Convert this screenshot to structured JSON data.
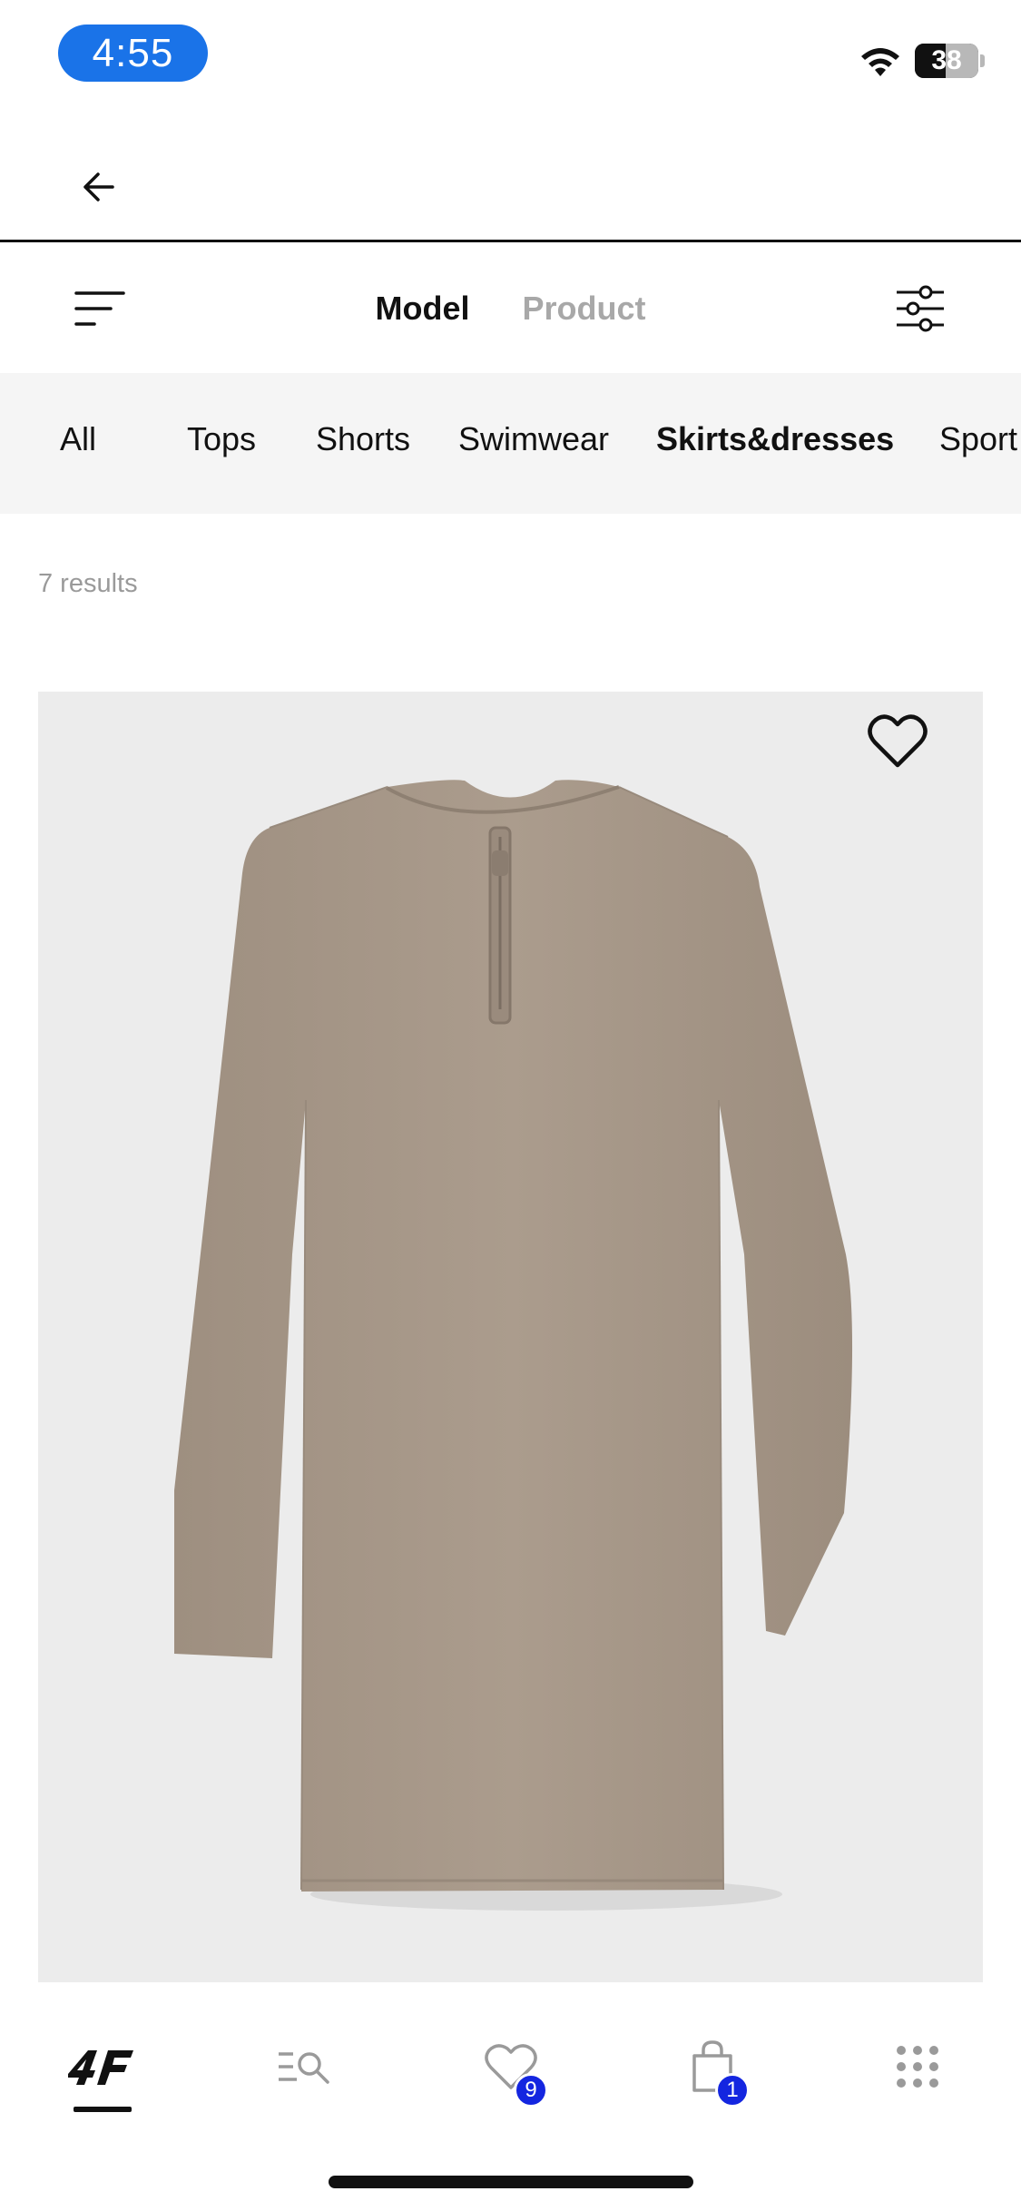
{
  "status_bar": {
    "time": "4:55",
    "battery": "38",
    "icons": [
      "wifi-icon",
      "battery-icon"
    ]
  },
  "header": {
    "back_icon": "arrow-left-icon"
  },
  "view_toggle": {
    "options": [
      "Model",
      "Product"
    ],
    "selected": "Model",
    "menu_icon": "sort-lines-icon",
    "filter_icon": "sliders-icon"
  },
  "categories": {
    "items": [
      "All",
      "Tops",
      "Shorts",
      "Swimwear",
      "Skirts&dresses",
      "Sport"
    ],
    "selected": "Skirts&dresses"
  },
  "results": {
    "label": "7 results"
  },
  "product": {
    "image": "long-sleeve-ribbed-dress",
    "favorite_icon": "heart-outline-icon",
    "dress_color": "#a8998a",
    "background_color": "#ececec"
  },
  "bottom_nav": {
    "items": [
      {
        "icon": "4f-logo-icon",
        "active": true
      },
      {
        "icon": "search-list-icon",
        "active": false
      },
      {
        "icon": "heart-icon",
        "badge": "9",
        "active": false
      },
      {
        "icon": "shopping-bag-icon",
        "badge": "1",
        "active": false
      },
      {
        "icon": "grid-dots-icon",
        "active": false
      }
    ],
    "badge_color": "#1426e0"
  }
}
